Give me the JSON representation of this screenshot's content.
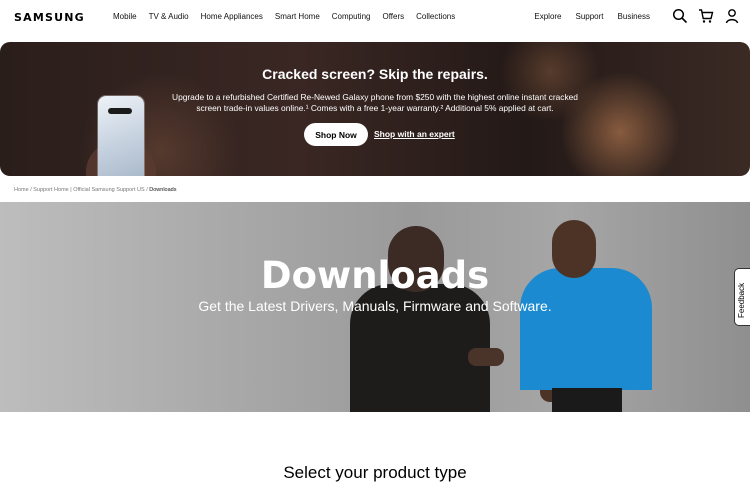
{
  "header": {
    "logo": "SAMSUNG",
    "nav": [
      "Mobile",
      "TV & Audio",
      "Home Appliances",
      "Smart Home",
      "Computing",
      "Offers",
      "Collections"
    ],
    "nav_right": [
      "Explore",
      "Support",
      "Business"
    ],
    "icons": [
      "search-icon",
      "cart-icon",
      "user-icon"
    ]
  },
  "promo": {
    "title": "Cracked screen? Skip the repairs.",
    "description": "Upgrade to a refurbished Certified Re-Newed Galaxy phone from $250 with the highest online instant cracked screen trade-in values online.¹ Comes with a free 1-year warranty.² Additional 5% applied at cart.",
    "shop_now": "Shop Now",
    "shop_expert": "Shop with an expert"
  },
  "breadcrumb": {
    "items": [
      "Home",
      "Support Home",
      "Official Samsung Support US"
    ],
    "current": "Downloads"
  },
  "hero": {
    "title": "Downloads",
    "subtitle": "Get the Latest Drivers, Manuals, Firmware and Software."
  },
  "feedback": {
    "label": "Feedback"
  },
  "product": {
    "heading": "Select your product type"
  }
}
